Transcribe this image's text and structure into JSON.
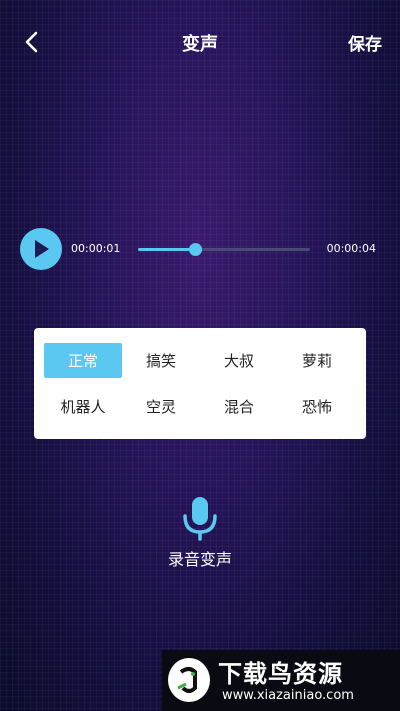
{
  "header": {
    "title": "变声",
    "save_label": "保存",
    "back_icon": "chevron-left-icon"
  },
  "player": {
    "current_time": "00:00:01",
    "total_time": "00:00:04",
    "progress": 0.33,
    "play_icon": "play-icon",
    "accent_color": "#5ac8f0"
  },
  "effects": {
    "items": [
      {
        "label": "正常",
        "selected": true
      },
      {
        "label": "搞笑",
        "selected": false
      },
      {
        "label": "大叔",
        "selected": false
      },
      {
        "label": "萝莉",
        "selected": false
      },
      {
        "label": "机器人",
        "selected": false
      },
      {
        "label": "空灵",
        "selected": false
      },
      {
        "label": "混合",
        "selected": false
      },
      {
        "label": "恐怖",
        "selected": false
      }
    ]
  },
  "record": {
    "label": "录音变声",
    "icon": "microphone-icon"
  },
  "watermark": {
    "title": "下载鸟资源",
    "url": "www.xiazainiao.com"
  }
}
